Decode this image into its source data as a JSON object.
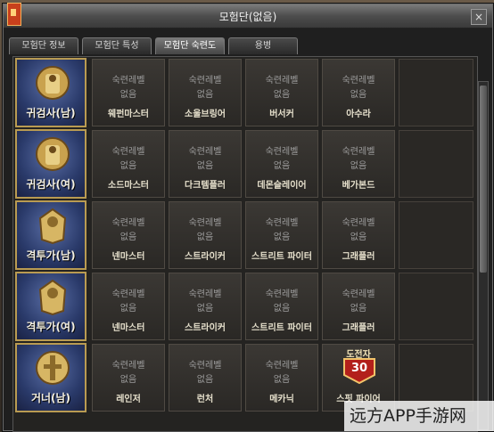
{
  "window": {
    "title": "모험단(없음)"
  },
  "tabs": [
    {
      "label": "모험단 정보",
      "active": false
    },
    {
      "label": "모험단 특성",
      "active": false
    },
    {
      "label": "모험단 숙련도",
      "active": true
    },
    {
      "label": "용병",
      "active": false
    }
  ],
  "help_label": "?",
  "close_label": "×",
  "cell_text": {
    "line1": "숙련레벨",
    "line2": "없음"
  },
  "rows": [
    {
      "character": "귀검사(남)",
      "subclasses": [
        "웨펀마스터",
        "소울브링어",
        "버서커",
        "아수라"
      ]
    },
    {
      "character": "귀검사(여)",
      "subclasses": [
        "소드마스터",
        "다크템플러",
        "데몬슬레이어",
        "베가본드"
      ]
    },
    {
      "character": "격투가(남)",
      "subclasses": [
        "넨마스터",
        "스트라이커",
        "스트리트 파이터",
        "그래플러"
      ]
    },
    {
      "character": "격투가(여)",
      "subclasses": [
        "넨마스터",
        "스트라이커",
        "스트리트 파이터",
        "그래플러"
      ]
    },
    {
      "character": "거너(남)",
      "subclasses": [
        "레인저",
        "런처",
        "메카닉",
        "스핏 파이어"
      ]
    }
  ],
  "challenger": {
    "label": "도전자",
    "level": "30"
  },
  "watermark": {
    "text": "远方APP手游网"
  },
  "colors": {
    "frame_gold": "#b99b52",
    "badge_red": "#b3201b",
    "accent_orange": "#d9a23a"
  }
}
